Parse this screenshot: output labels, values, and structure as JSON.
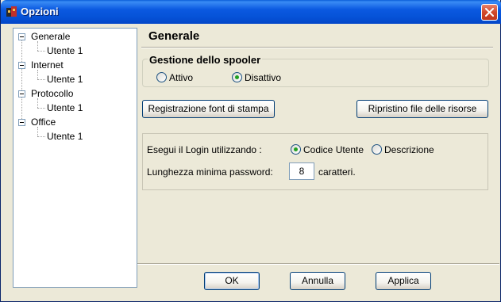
{
  "window": {
    "title": "Opzioni"
  },
  "tree": {
    "items": [
      {
        "label": "Generale",
        "child": "Utente  1"
      },
      {
        "label": "Internet",
        "child": "Utente  1"
      },
      {
        "label": "Protocollo",
        "child": "Utente  1"
      },
      {
        "label": "Office",
        "child": "Utente  1"
      }
    ]
  },
  "panel": {
    "title": "Generale",
    "spooler": {
      "label": "Gestione dello spooler",
      "options": [
        "Attivo",
        "Disattivo"
      ],
      "selected": "Disattivo"
    },
    "buttons": {
      "font": "Registrazione font di stampa",
      "restore": "Ripristino file delle risorse"
    },
    "login": {
      "label": "Esegui il Login utilizzando :",
      "options": [
        "Codice Utente",
        "Descrizione"
      ],
      "selected": "Codice Utente"
    },
    "password": {
      "label": "Lunghezza minima password:",
      "value": "8",
      "unit": "caratteri."
    }
  },
  "footer": {
    "ok": "OK",
    "cancel": "Annulla",
    "apply": "Applica"
  },
  "colors": {
    "titlebar": "#0B59E0",
    "close": "#D2492B",
    "face": "#ECE9D8",
    "radio_dot": "#21A121"
  }
}
